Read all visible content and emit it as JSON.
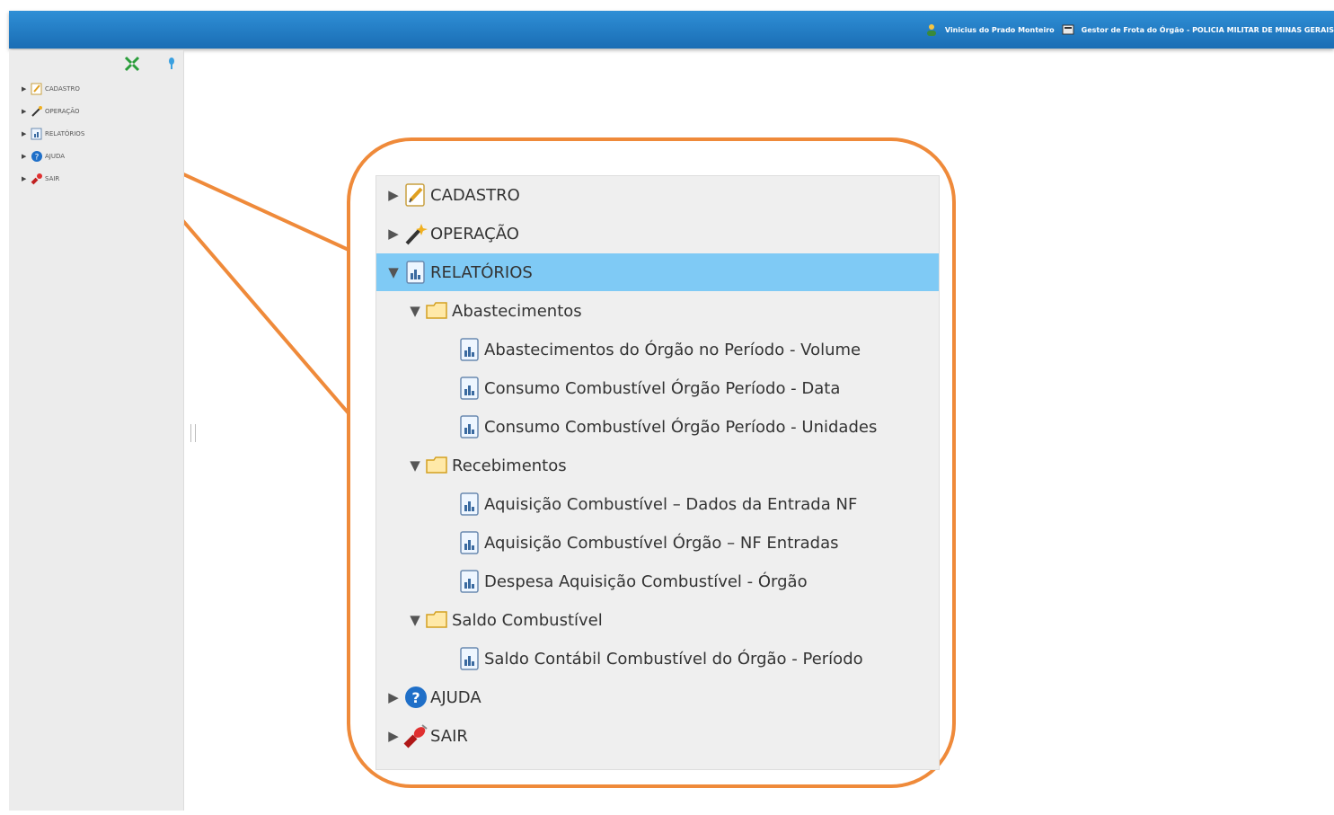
{
  "header": {
    "user_name": "Vinicius do Prado Monteiro",
    "role": "Gestor de Frota do Órgão - POLICIA MILITAR DE MINAS GERAIS"
  },
  "sidebar": {
    "items": [
      {
        "label": "CADASTRO",
        "icon": "edit-icon"
      },
      {
        "label": "OPERAÇÃO",
        "icon": "wand-icon"
      },
      {
        "label": "RELATÓRIOS",
        "icon": "report-icon"
      },
      {
        "label": "AJUDA",
        "icon": "help-icon"
      },
      {
        "label": "SAIR",
        "icon": "exit-icon"
      }
    ]
  },
  "tree": {
    "cadastro": "CADASTRO",
    "operacao": "OPERAÇÃO",
    "relatorios": "RELATÓRIOS",
    "abastecimentos": {
      "label": "Abastecimentos",
      "items": [
        "Abastecimentos do Órgão no Período - Volume",
        "Consumo Combustível Órgão Período - Data",
        "Consumo Combustível Órgão Período - Unidades"
      ]
    },
    "recebimentos": {
      "label": "Recebimentos",
      "items": [
        "Aquisição Combustível – Dados da Entrada NF",
        "Aquisição Combustível Órgão – NF Entradas",
        "Despesa Aquisição Combustível - Órgão"
      ]
    },
    "saldo": {
      "label": "Saldo Combustível",
      "items": [
        "Saldo Contábil Combustível do Órgão - Período"
      ]
    },
    "ajuda": "AJUDA",
    "sair": "SAIR"
  },
  "colors": {
    "topbar": "#1a6db4",
    "selected": "#7fcaf5",
    "callout": "#ef8a3a"
  }
}
